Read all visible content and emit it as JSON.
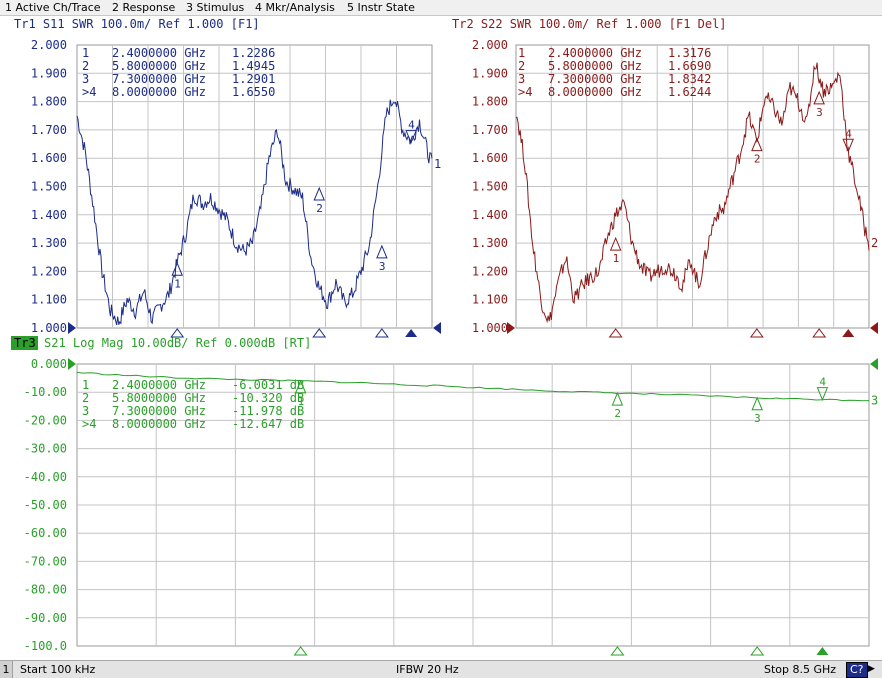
{
  "menu": [
    "1 Active Ch/Trace",
    "2 Response",
    "3 Stimulus",
    "4 Mkr/Analysis",
    "5 Instr State"
  ],
  "colors": {
    "tr1": "#1c2c88",
    "tr2": "#8b1a1a",
    "tr3": "#2aa02a",
    "grid": "#c4c4c4"
  },
  "status": {
    "channel": "1",
    "start": "Start 100 kHz",
    "ifbw": "IFBW 20 Hz",
    "stop": "Stop 8.5 GHz",
    "cal": "C?",
    "arrow": "▶"
  },
  "traces": [
    {
      "id": "tr1",
      "header": {
        "tr": "Tr1",
        "rest": "S11  SWR 100.0m/  Ref 1.000  [F1]"
      },
      "yticks": [
        "2.000",
        "1.900",
        "1.800",
        "1.700",
        "1.600",
        "1.500",
        "1.400",
        "1.300",
        "1.200",
        "1.100",
        "1.000"
      ],
      "ylim": [
        1.0,
        2.0
      ],
      "markers": [
        {
          "id": "1",
          "freq": "2.4000000 GHz",
          "value": "1.2286",
          "active": false,
          "x_ghz": 2.4,
          "y": 1.2286
        },
        {
          "id": "2",
          "freq": "5.8000000 GHz",
          "value": "1.4945",
          "active": false,
          "x_ghz": 5.8,
          "y": 1.4945
        },
        {
          "id": "3",
          "freq": "7.3000000 GHz",
          "value": "1.2901",
          "active": false,
          "x_ghz": 7.3,
          "y": 1.2901
        },
        {
          "id": "4",
          "freq": "8.0000000 GHz",
          "value": "1.6550",
          "active": true,
          "x_ghz": 8.0,
          "y": 1.655
        }
      ],
      "end_label": "1"
    },
    {
      "id": "tr2",
      "header": {
        "tr": "Tr2",
        "rest": "S22  SWR 100.0m/  Ref 1.000  [F1 Del]"
      },
      "yticks": [
        "2.000",
        "1.900",
        "1.800",
        "1.700",
        "1.600",
        "1.500",
        "1.400",
        "1.300",
        "1.200",
        "1.100",
        "1.000"
      ],
      "ylim": [
        1.0,
        2.0
      ],
      "markers": [
        {
          "id": "1",
          "freq": "2.4000000 GHz",
          "value": "1.3176",
          "active": false,
          "x_ghz": 2.4,
          "y": 1.3176
        },
        {
          "id": "2",
          "freq": "5.8000000 GHz",
          "value": "1.6690",
          "active": false,
          "x_ghz": 5.8,
          "y": 1.669
        },
        {
          "id": "3",
          "freq": "7.3000000 GHz",
          "value": "1.8342",
          "active": false,
          "x_ghz": 7.3,
          "y": 1.8342
        },
        {
          "id": "4",
          "freq": "8.0000000 GHz",
          "value": "1.6244",
          "active": true,
          "x_ghz": 8.0,
          "y": 1.6244
        }
      ],
      "end_label": "2"
    },
    {
      "id": "tr3",
      "header": {
        "tr": "Tr3",
        "rest": "S21  Log Mag  10.00dB/  Ref 0.000dB  [RT]"
      },
      "yticks": [
        "0.000",
        "-10.00",
        "-20.00",
        "-30.00",
        "-40.00",
        "-50.00",
        "-60.00",
        "-70.00",
        "-80.00",
        "-90.00",
        "-100.0"
      ],
      "ylim": [
        -100,
        0
      ],
      "markers": [
        {
          "id": "1",
          "freq": "2.4000000 GHz",
          "value": "-6.0031  dB",
          "active": false,
          "x_ghz": 2.4,
          "y": -6.0031
        },
        {
          "id": "2",
          "freq": "5.8000000 GHz",
          "value": "-10.320  dB",
          "active": false,
          "x_ghz": 5.8,
          "y": -10.32
        },
        {
          "id": "3",
          "freq": "7.3000000 GHz",
          "value": "-11.978  dB",
          "active": false,
          "x_ghz": 7.3,
          "y": -11.978
        },
        {
          "id": "4",
          "freq": "8.0000000 GHz",
          "value": "-12.647  dB",
          "active": true,
          "x_ghz": 8.0,
          "y": -12.647
        }
      ],
      "end_label": "3"
    }
  ],
  "chart_data": [
    {
      "type": "line",
      "title": "Tr1  S11  SWR 100.0m/  Ref 1.000  [F1]",
      "xlim_ghz": [
        0.0001,
        8.5
      ],
      "ylim": [
        1.0,
        2.0
      ],
      "x": [
        0.0001,
        0.2,
        0.4,
        0.6,
        0.8,
        1.0,
        1.2,
        1.4,
        1.6,
        1.8,
        2.0,
        2.2,
        2.4,
        2.6,
        2.8,
        3.0,
        3.2,
        3.4,
        3.6,
        3.8,
        4.0,
        4.2,
        4.4,
        4.6,
        4.8,
        5.0,
        5.2,
        5.4,
        5.6,
        5.8,
        6.0,
        6.2,
        6.4,
        6.6,
        6.8,
        7.0,
        7.2,
        7.4,
        7.6,
        7.8,
        8.0,
        8.2,
        8.4,
        8.5
      ],
      "series": [
        {
          "values": [
            1.75,
            1.62,
            1.42,
            1.2,
            1.06,
            1.02,
            1.1,
            1.06,
            1.13,
            1.03,
            1.08,
            1.12,
            1.23,
            1.33,
            1.47,
            1.44,
            1.46,
            1.42,
            1.38,
            1.3,
            1.27,
            1.3,
            1.42,
            1.6,
            1.7,
            1.52,
            1.49,
            1.46,
            1.25,
            1.14,
            1.09,
            1.16,
            1.09,
            1.12,
            1.2,
            1.29,
            1.5,
            1.75,
            1.82,
            1.7,
            1.66,
            1.73,
            1.62,
            1.58
          ]
        }
      ]
    },
    {
      "type": "line",
      "title": "Tr2  S22  SWR 100.0m/  Ref 1.000  [F1 Del]",
      "xlim_ghz": [
        0.0001,
        8.5
      ],
      "ylim": [
        1.0,
        2.0
      ],
      "x": [
        0.0001,
        0.2,
        0.4,
        0.6,
        0.8,
        1.0,
        1.2,
        1.4,
        1.6,
        1.8,
        2.0,
        2.2,
        2.4,
        2.6,
        2.8,
        3.0,
        3.2,
        3.4,
        3.6,
        3.8,
        4.0,
        4.2,
        4.4,
        4.6,
        4.8,
        5.0,
        5.2,
        5.4,
        5.6,
        5.8,
        6.0,
        6.2,
        6.4,
        6.6,
        6.8,
        7.0,
        7.2,
        7.4,
        7.6,
        7.8,
        8.0,
        8.2,
        8.4,
        8.5
      ],
      "series": [
        {
          "values": [
            1.77,
            1.6,
            1.3,
            1.1,
            1.02,
            1.15,
            1.25,
            1.1,
            1.15,
            1.18,
            1.2,
            1.32,
            1.4,
            1.44,
            1.3,
            1.22,
            1.18,
            1.2,
            1.22,
            1.2,
            1.15,
            1.24,
            1.15,
            1.28,
            1.4,
            1.42,
            1.52,
            1.62,
            1.75,
            1.66,
            1.82,
            1.78,
            1.72,
            1.85,
            1.8,
            1.72,
            1.94,
            1.84,
            1.85,
            1.9,
            1.62,
            1.5,
            1.35,
            1.3
          ]
        }
      ]
    },
    {
      "type": "line",
      "title": "Tr3  S21  Log Mag  10.00dB/  Ref 0.000dB  [RT]",
      "xlim_ghz": [
        0.0001,
        8.5
      ],
      "ylim": [
        -100,
        0
      ],
      "x": [
        0.0001,
        0.5,
        1.0,
        1.5,
        2.0,
        2.4,
        3.0,
        3.5,
        4.0,
        4.5,
        5.0,
        5.5,
        5.8,
        6.0,
        6.5,
        7.0,
        7.3,
        7.5,
        8.0,
        8.5
      ],
      "series": [
        {
          "values": [
            -3.0,
            -4.0,
            -4.8,
            -5.3,
            -5.7,
            -6.0,
            -6.6,
            -7.3,
            -7.9,
            -8.7,
            -9.4,
            -10.0,
            -10.3,
            -10.5,
            -11.0,
            -11.6,
            -12.0,
            -12.2,
            -12.6,
            -12.9
          ]
        }
      ]
    }
  ]
}
